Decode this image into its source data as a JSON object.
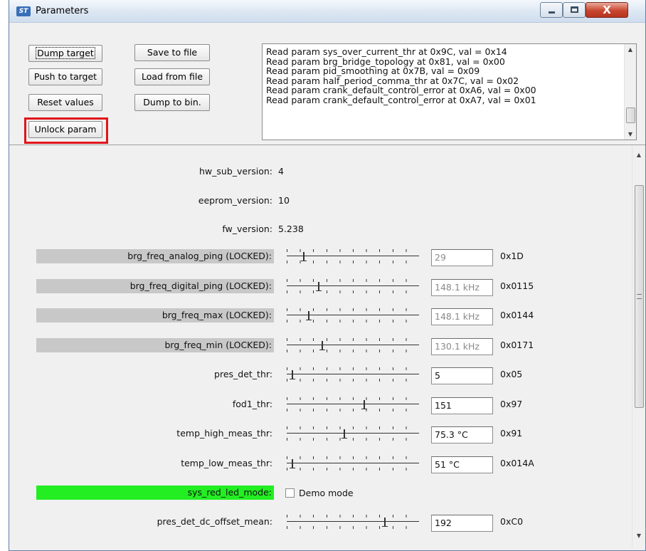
{
  "window": {
    "title": "Parameters",
    "app_icon_text": "ST",
    "controls": {
      "minimize": "",
      "maximize": "",
      "close": "X"
    }
  },
  "toolbar": {
    "dump_target": "Dump target",
    "push_to_target": "Push to target",
    "reset_values": "Reset values",
    "unlock_param": "Unlock param",
    "save_to_file": "Save to file",
    "load_from_file": "Load from file",
    "dump_to_bin": "Dump to bin."
  },
  "log": {
    "lines": [
      "Read param sys_over_current_thr at 0x9C, val = 0x14",
      "Read param brg_bridge_topology at 0x81, val = 0x00",
      "Read param pid_smoothing at 0x7B, val = 0x09",
      "Read param half_period_comma_thr at 0x7C, val = 0x02",
      "Read param crank_default_control_error at 0xA6, val = 0x00",
      "Read param crank_default_control_error at 0xA7, val = 0x01"
    ],
    "scroll_fraction": 0.9
  },
  "info": {
    "hw_sub_version": {
      "label": "hw_sub_version:",
      "value": "4"
    },
    "eeprom_version": {
      "label": "eeprom_version:",
      "value": "10"
    },
    "fw_version": {
      "label": "fw_version:",
      "value": "5.238"
    }
  },
  "params": [
    {
      "label": "brg_freq_analog_ping (LOCKED):",
      "value": "29",
      "hex": "0x1D",
      "locked": true,
      "slider_fraction": 0.11
    },
    {
      "label": "brg_freq_digital_ping (LOCKED):",
      "value": "148.1 kHz",
      "hex": "0x0115",
      "locked": true,
      "slider_fraction": 0.23
    },
    {
      "label": "brg_freq_max (LOCKED):",
      "value": "148.1 kHz",
      "hex": "0x0144",
      "locked": true,
      "slider_fraction": 0.15
    },
    {
      "label": "brg_freq_min (LOCKED):",
      "value": "130.1 kHz",
      "hex": "0x0171",
      "locked": true,
      "slider_fraction": 0.26
    },
    {
      "label": "pres_det_thr:",
      "value": "5",
      "hex": "0x05",
      "locked": false,
      "slider_fraction": 0.02
    },
    {
      "label": "fod1_thr:",
      "value": "151",
      "hex": "0x97",
      "locked": false,
      "slider_fraction": 0.59
    },
    {
      "label": "temp_high_meas_thr:",
      "value": "75.3 °C",
      "hex": "0x91",
      "locked": false,
      "slider_fraction": 0.43
    },
    {
      "label": "temp_low_meas_thr:",
      "value": "51 °C",
      "hex": "0x014A",
      "locked": false,
      "slider_fraction": 0.02
    }
  ],
  "sys_red_led_mode": {
    "label": "sys_red_led_mode:",
    "checkbox_label": "Demo mode",
    "checked": false
  },
  "last_param": {
    "label": "pres_det_dc_offset_mean:",
    "value": "192",
    "hex": "0xC0",
    "slider_fraction": 0.75
  },
  "content_scroll_fraction": 0.0,
  "colors": {
    "locked_bg": "#c8c8c8",
    "highlight_green": "#22ee22",
    "focus_box": "#e0141b"
  }
}
